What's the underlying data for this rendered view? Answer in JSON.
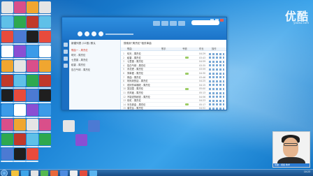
{
  "desktop": {
    "watermark": "优酷",
    "watermark_sub": "youku.com"
  },
  "player": {
    "list_title": "新建列表 (12首) 默认",
    "main_title": "搜索到“周杰伦”相关单曲",
    "columns": [
      "歌曲",
      "歌手",
      "专辑",
      "时长",
      "操作"
    ],
    "list_rows": [
      "歌曲一 - 周杰伦",
      "晴天 - 周杰伦",
      "七里香 - 周杰伦",
      "稻香 - 周杰伦",
      "告白气球 - 周杰伦"
    ],
    "songs": [
      {
        "idx": "1",
        "name": "晴天 - 周杰伦",
        "dur": "04:29"
      },
      {
        "idx": "2",
        "name": "稻香 - 周杰伦",
        "dur": "03:43"
      },
      {
        "idx": "3",
        "name": "七里香 - 周杰伦",
        "dur": "04:59"
      },
      {
        "idx": "4",
        "name": "告白气球 - 周杰伦",
        "dur": "03:35"
      },
      {
        "idx": "5",
        "name": "青花瓷 - 周杰伦",
        "dur": "03:59"
      },
      {
        "idx": "6",
        "name": "简单爱 - 周杰伦",
        "dur": "04:30"
      },
      {
        "idx": "7",
        "name": "夜曲 - 周杰伦",
        "dur": "03:46"
      },
      {
        "idx": "8",
        "name": "听妈妈的话 - 周杰伦",
        "dur": "04:25"
      },
      {
        "idx": "9",
        "name": "说好的幸福呢 - 周杰伦",
        "dur": "04:15"
      },
      {
        "idx": "10",
        "name": "发如雪 - 周杰伦",
        "dur": "05:00"
      },
      {
        "idx": "11",
        "name": "东风破 - 周杰伦",
        "dur": "05:13"
      },
      {
        "idx": "12",
        "name": "不能说的秘密 - 周杰伦",
        "dur": "04:56"
      },
      {
        "idx": "13",
        "name": "彩虹 - 周杰伦",
        "dur": "04:23"
      },
      {
        "idx": "14",
        "name": "半岛铁盒 - 周杰伦",
        "dur": "05:17"
      },
      {
        "idx": "15",
        "name": "菊花台 - 周杰伦",
        "dur": "04:52"
      }
    ]
  },
  "webcam": {
    "tag": "优酷 - 视频 教学"
  },
  "taskbar": {
    "time": "10:23",
    "date": "2015/3/8"
  },
  "colors": {
    "accent": "#1b73c8",
    "desktop": "#1f87d8"
  }
}
